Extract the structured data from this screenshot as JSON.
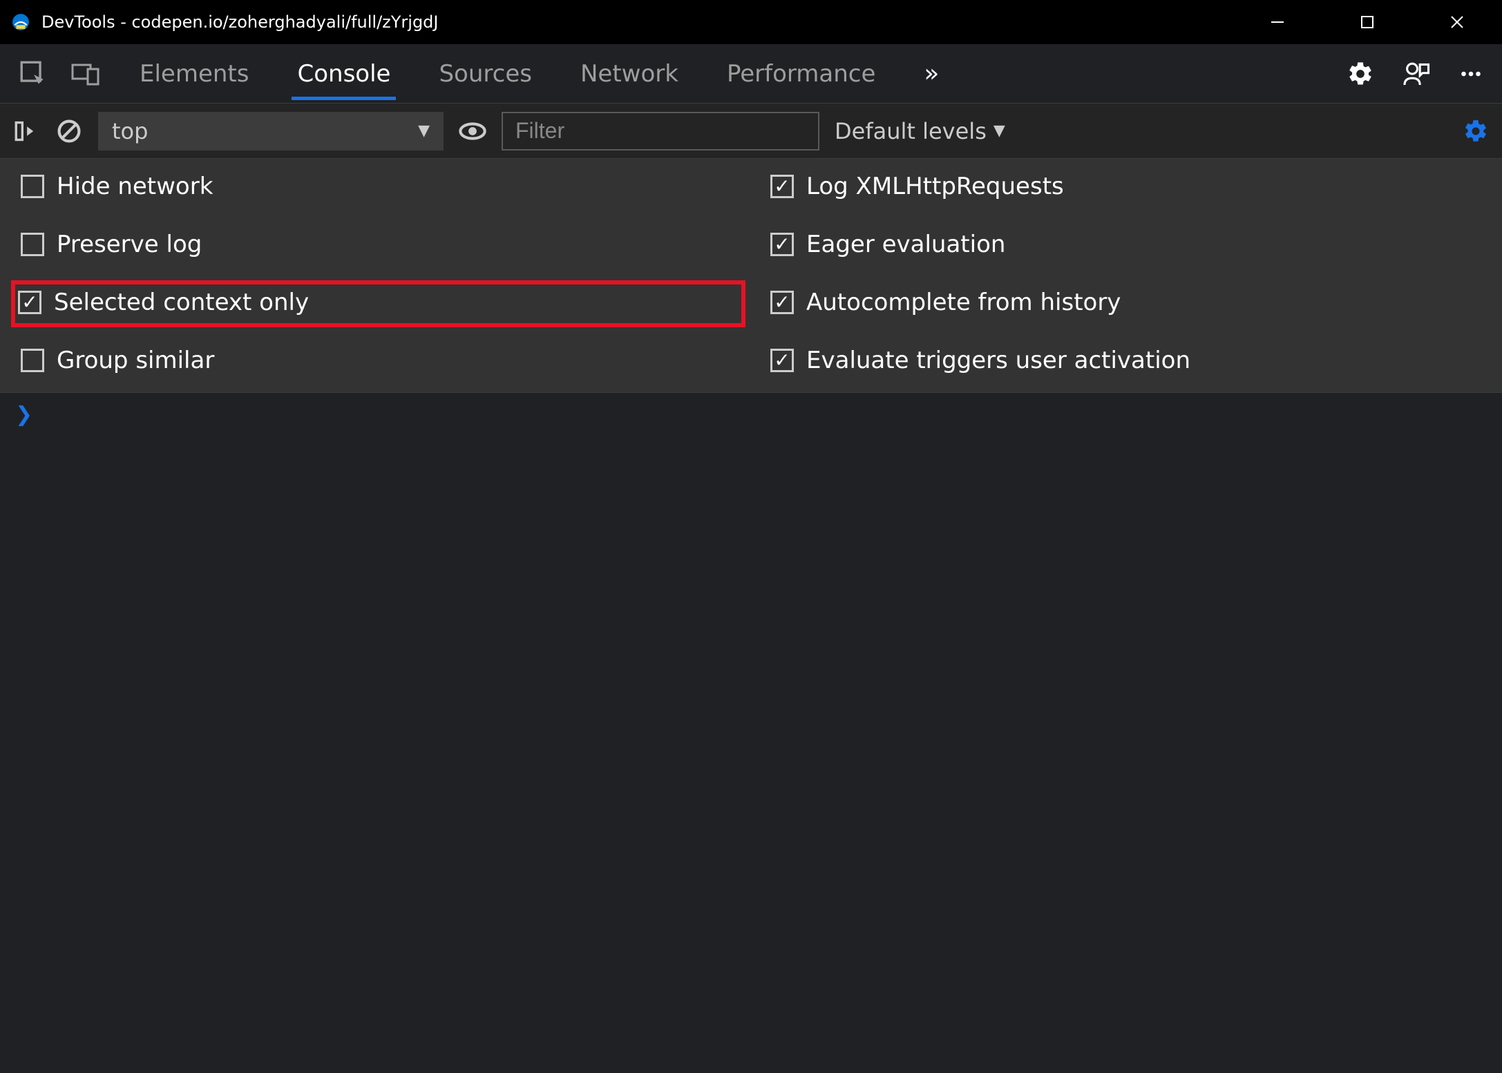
{
  "window": {
    "title": "DevTools - codepen.io/zoherghadyali/full/zYrjgdJ"
  },
  "tabs": {
    "items": [
      "Elements",
      "Console",
      "Sources",
      "Network",
      "Performance"
    ],
    "active": "Console",
    "more": "»"
  },
  "toolbar": {
    "context": "top",
    "filter_placeholder": "Filter",
    "levels": "Default levels"
  },
  "settings": {
    "left": [
      {
        "label": "Hide network",
        "checked": false,
        "highlighted": false
      },
      {
        "label": "Preserve log",
        "checked": false,
        "highlighted": false
      },
      {
        "label": "Selected context only",
        "checked": true,
        "highlighted": true
      },
      {
        "label": "Group similar",
        "checked": false,
        "highlighted": false
      }
    ],
    "right": [
      {
        "label": "Log XMLHttpRequests",
        "checked": true,
        "highlighted": false
      },
      {
        "label": "Eager evaluation",
        "checked": true,
        "highlighted": false
      },
      {
        "label": "Autocomplete from history",
        "checked": true,
        "highlighted": false
      },
      {
        "label": "Evaluate triggers user activation",
        "checked": true,
        "highlighted": false
      }
    ]
  },
  "console": {
    "prompt": "❯"
  },
  "colors": {
    "accent": "#1a73e8",
    "highlight": "#e81123"
  }
}
